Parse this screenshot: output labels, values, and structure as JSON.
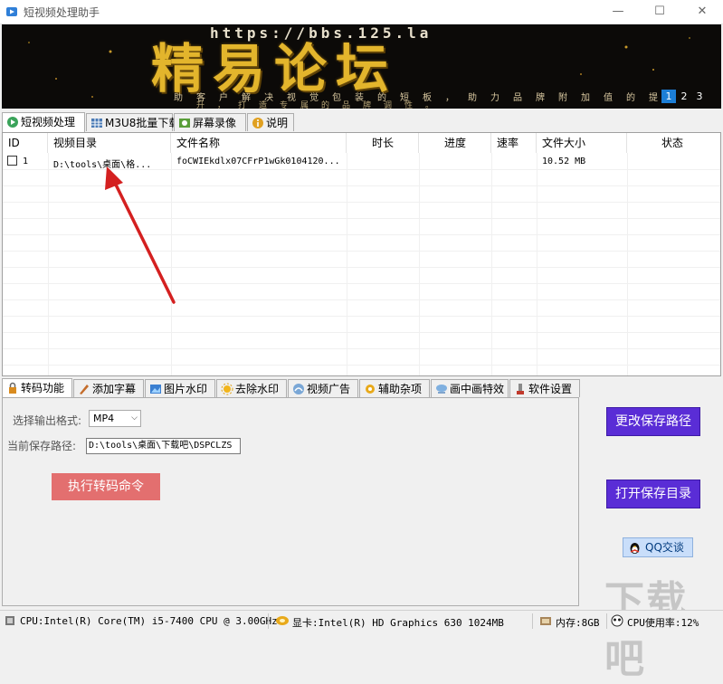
{
  "window": {
    "title": "短视频处理助手",
    "minimize": "—",
    "maximize": "☐",
    "close": "✕"
  },
  "banner": {
    "url": "https://bbs.125.la",
    "headline": "精易论坛",
    "slogan_line1": "助客户解决视觉包装的短板，助力品牌附加值的提",
    "slogan_line2": "升，打造专属的品牌调性。",
    "pages": [
      "1",
      "2",
      "3"
    ],
    "active_page": "1"
  },
  "top_tabs": [
    {
      "label": "短视频处理",
      "icon": "video-tab-icon"
    },
    {
      "label": "M3U8批量下载",
      "icon": "grid-icon"
    },
    {
      "label": "屏幕录像",
      "icon": "record-icon"
    },
    {
      "label": "说明",
      "icon": "info-icon"
    }
  ],
  "table": {
    "columns": [
      "ID",
      "视频目录",
      "文件名称",
      "时长",
      "进度",
      "速率",
      "文件大小",
      "状态"
    ],
    "rows": [
      {
        "id": "1",
        "dir": "D:\\tools\\桌面\\格...",
        "name": "foCWIEkdlx07CFrP1wGk0104120...",
        "duration": "",
        "progress": "",
        "rate": "",
        "size": "10.52 MB",
        "status": ""
      }
    ]
  },
  "bottom_tabs": [
    {
      "label": "转码功能",
      "icon": "lock-icon"
    },
    {
      "label": "添加字幕",
      "icon": "subtitle-icon"
    },
    {
      "label": "图片水印",
      "icon": "image-icon"
    },
    {
      "label": "去除水印",
      "icon": "sun-icon"
    },
    {
      "label": "视频广告",
      "icon": "ad-icon"
    },
    {
      "label": "辅助杂项",
      "icon": "tools-icon"
    },
    {
      "label": "画中画特效",
      "icon": "pip-icon"
    },
    {
      "label": "软件设置",
      "icon": "settings-icon"
    }
  ],
  "convert": {
    "format_label": "选择输出格式:",
    "format_value": "MP4",
    "path_label": "当前保存路径:",
    "path_value": "D:\\tools\\桌面\\下载吧\\DSPCLZS",
    "run_button": "执行转码命令"
  },
  "side_buttons": {
    "change_path": "更改保存路径",
    "open_dir": "打开保存目录",
    "qq": "QQ交谈"
  },
  "status": {
    "cpu": "CPU:Intel(R) Core(TM) i5-7400 CPU @ 3.00GHz",
    "gpu": "显卡:Intel(R) HD Graphics 630   1024MB",
    "memory": "内存:8GB",
    "cpu_usage": "CPU使用率:12%"
  },
  "watermark": "下载吧",
  "colors": {
    "accent_purple": "#5a2dd6",
    "run_red": "#e36f6f",
    "banner_gold": "#e3b52c",
    "page_active": "#1c7ed6"
  }
}
